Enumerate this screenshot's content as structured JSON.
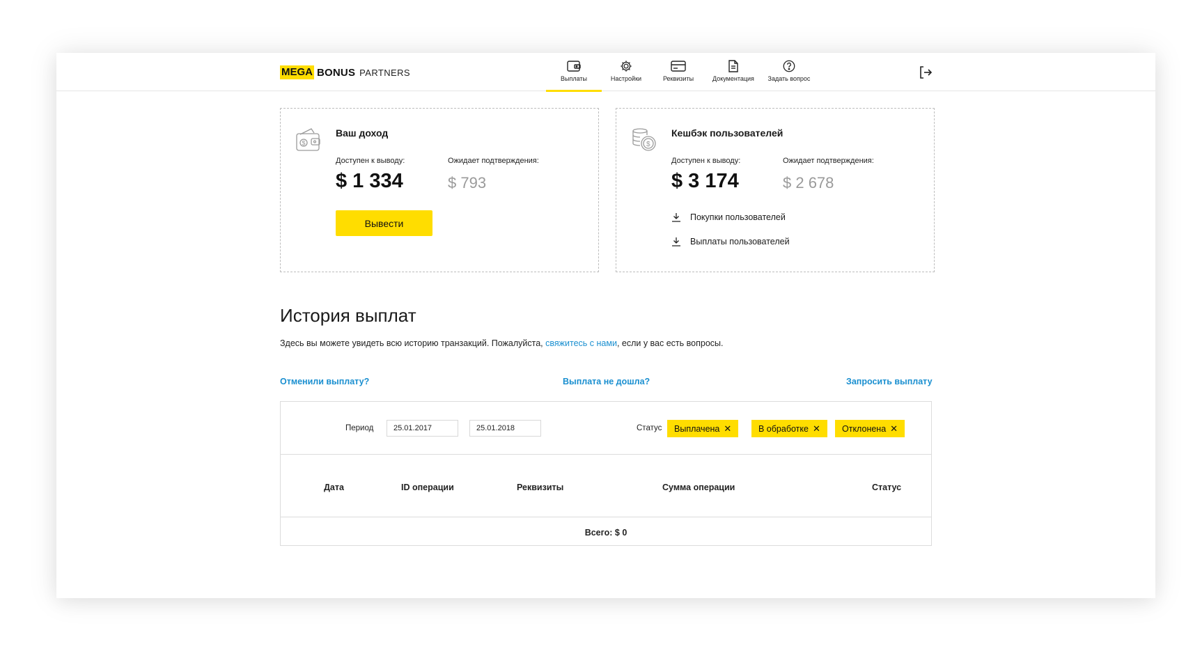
{
  "brand": {
    "mega": "MEGA",
    "bonus": "BONUS",
    "partners": "PARTNERS",
    "accent": "#FFDD00"
  },
  "nav": [
    {
      "label": "Выплаты",
      "icon": "wallet-icon",
      "active": true
    },
    {
      "label": "Настройки",
      "icon": "gear-icon",
      "active": false
    },
    {
      "label": "Реквизиты",
      "icon": "card-icon",
      "active": false
    },
    {
      "label": "Документация",
      "icon": "document-icon",
      "active": false
    },
    {
      "label": "Задать вопрос",
      "icon": "question-icon",
      "active": false
    }
  ],
  "logout_icon": "logout-icon",
  "income": {
    "title": "Ваш доход",
    "available_label": "Доступен к выводу:",
    "available": "$ 1 334",
    "pending_label": "Ожидает подтверждения:",
    "pending": "$ 793",
    "withdraw_button": "Вывести",
    "icon": "wallet-money-icon"
  },
  "cashback": {
    "title": "Кешбэк пользователей",
    "available_label": "Доступен к выводу:",
    "available": "$ 3 174",
    "pending_label": "Ожидает подтверждения:",
    "pending": "$ 2 678",
    "icon": "coins-icon",
    "links": [
      "Покупки пользователей",
      "Выплаты пользователей"
    ]
  },
  "history": {
    "title": "История выплат",
    "desc_before": "Здесь вы можете увидеть всю историю транзакций. Пожалуйста, ",
    "desc_link": "свяжитесь с нами",
    "desc_after": ", если у вас есть вопросы.",
    "links": {
      "cancelled": "Отменили выплату?",
      "not_arrived": "Выплата не дошла?",
      "request": "Запросить выплату"
    }
  },
  "filters": {
    "period_label": "Период",
    "date_from": "25.01.2017",
    "date_to": "25.01.2018",
    "status_label": "Статус",
    "chips": [
      "Выплачена",
      "В обработке",
      "Отклонена"
    ]
  },
  "table": {
    "columns": [
      "Дата",
      "ID операции",
      "Реквизиты",
      "Сумма операции",
      "Статус"
    ],
    "total": "Всего: $ 0"
  }
}
